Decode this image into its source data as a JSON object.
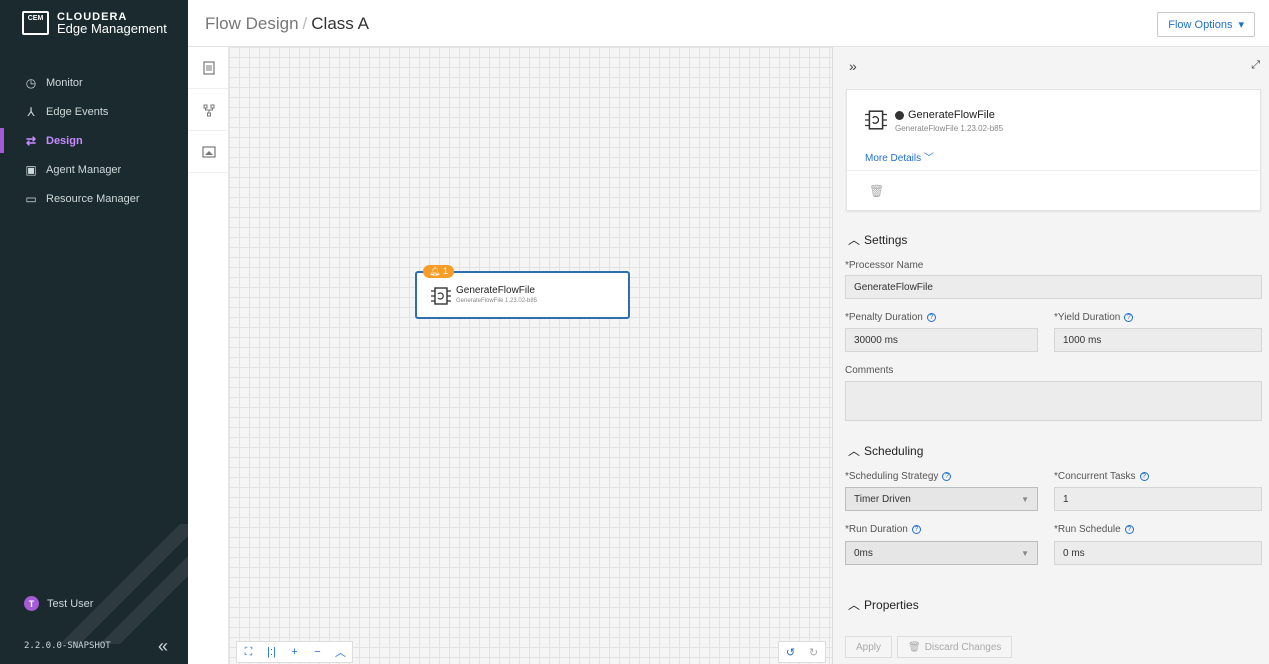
{
  "sidebar": {
    "logo_badge": "CEM",
    "brand": "CLOUDERA",
    "product": "Edge Management",
    "items": [
      {
        "label": "Monitor",
        "icon": "gauge-icon"
      },
      {
        "label": "Edge Events",
        "icon": "person-icon"
      },
      {
        "label": "Design",
        "icon": "flow-icon",
        "active": true
      },
      {
        "label": "Agent Manager",
        "icon": "agent-icon"
      },
      {
        "label": "Resource Manager",
        "icon": "folder-icon"
      }
    ],
    "user_initial": "T",
    "user_name": "Test User",
    "version": "2.2.0.0-SNAPSHOT"
  },
  "header": {
    "crumb_root": "Flow Design",
    "separator": "/",
    "crumb_current": "Class A",
    "flow_options_label": "Flow Options"
  },
  "canvas": {
    "node": {
      "badge": "1",
      "title": "GenerateFlowFile",
      "subtitle": "GenerateFlowFile 1.23.02-b85"
    }
  },
  "panel": {
    "card": {
      "title": "GenerateFlowFile",
      "subtitle": "GenerateFlowFile 1.23.02-b85",
      "more_details": "More Details"
    },
    "settings": {
      "heading": "Settings",
      "processor_name_label": "*Processor Name",
      "processor_name": "GenerateFlowFile",
      "penalty_label": "*Penalty Duration",
      "penalty": "30000 ms",
      "yield_label": "*Yield Duration",
      "yield": "1000 ms",
      "comments_label": "Comments",
      "comments": ""
    },
    "scheduling": {
      "heading": "Scheduling",
      "strategy_label": "*Scheduling Strategy",
      "strategy": "Timer Driven",
      "concurrent_label": "*Concurrent Tasks",
      "concurrent": "1",
      "run_duration_label": "*Run Duration",
      "run_duration": "0ms",
      "run_schedule_label": "*Run Schedule",
      "run_schedule": "0 ms"
    },
    "properties": {
      "heading": "Properties"
    },
    "footer": {
      "apply": "Apply",
      "discard": "Discard Changes"
    }
  },
  "colors": {
    "sidebar_bg": "#1b2a2f",
    "accent_purple": "#a35bd6",
    "link_blue": "#1f6fcf",
    "node_border": "#2f6fb0",
    "badge_orange": "#f79c25"
  }
}
